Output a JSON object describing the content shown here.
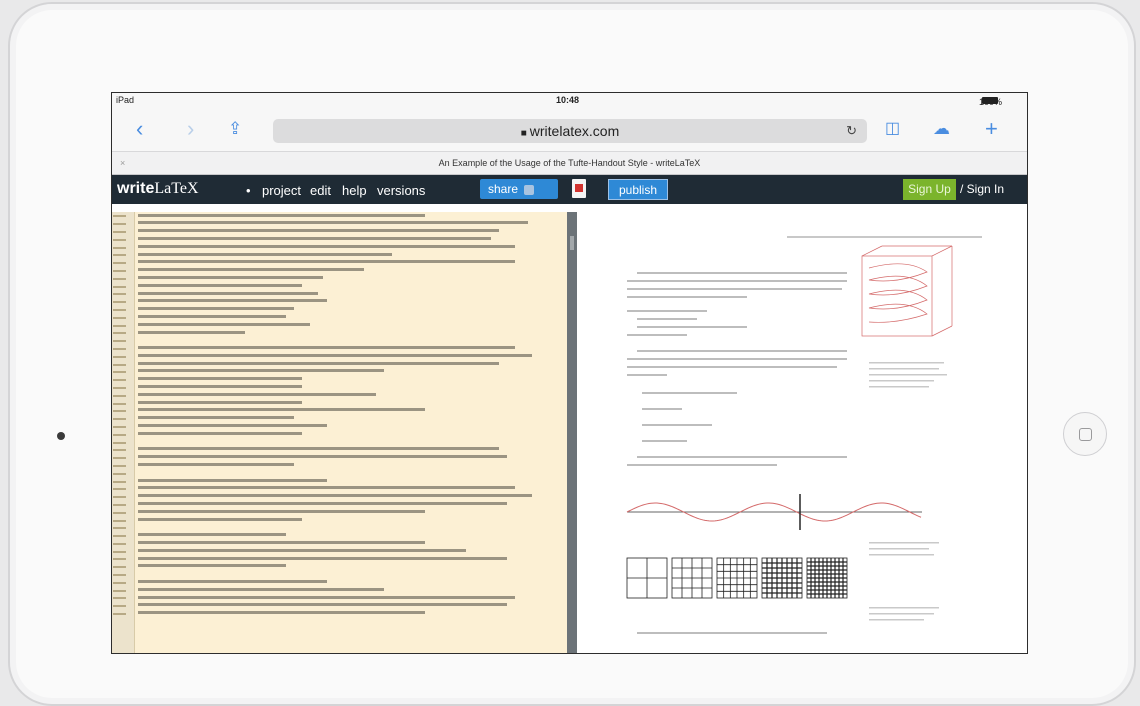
{
  "status_bar": {
    "carrier": "iPad",
    "time": "10:48",
    "battery": "100%"
  },
  "browser": {
    "url": "writelatex.com",
    "page_title": "An Example of the Usage of the Tufte-Handout Style - writeLaTeX",
    "icons": [
      "back-icon",
      "forward-icon",
      "share-icon",
      "reload-icon",
      "bookmarks-icon",
      "cloud-tabs-icon",
      "new-tab-icon",
      "close-tab-icon"
    ]
  },
  "app_nav": {
    "logo_write": "write",
    "logo_latex": "LaTeX",
    "menu": [
      "project",
      "edit",
      "help",
      "versions"
    ],
    "share_label": "share",
    "publish_label": "publish",
    "signup_label": "Sign Up",
    "signin_label": "/ Sign In"
  },
  "colors": {
    "nav_bg": "#1f2b35",
    "editor_bg": "#fcf0d4",
    "accent_blue": "#2e89d6",
    "signup_green": "#7bb42c"
  }
}
